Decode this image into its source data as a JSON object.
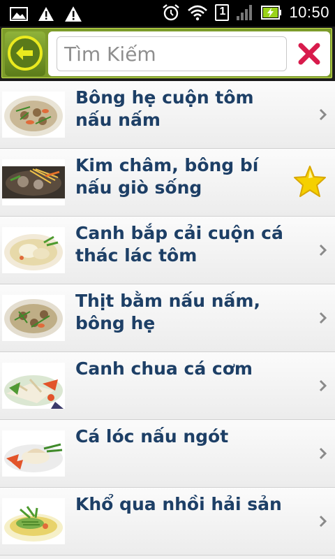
{
  "status_bar": {
    "time": "10:50",
    "sim_slot": "1",
    "icons": [
      "image-notification-icon",
      "warning-icon",
      "warning-icon",
      "alarm-icon",
      "wifi-icon",
      "sim-icon",
      "signal-icon",
      "battery-charging-icon"
    ]
  },
  "search": {
    "placeholder": "Tìm Kiếm",
    "value": ""
  },
  "colors": {
    "title_text": "#1d3f66",
    "toolbar_green": "#7d9c2b",
    "back_button_yellow": "#e8e81e",
    "clear_x": "#d81b4c",
    "star": "#f5d000"
  },
  "recipes": [
    {
      "title": "Bông hẹ cuộn tôm nấu nấm",
      "favorite": false
    },
    {
      "title": "Kim châm, bông bí nấu giò sống",
      "favorite": true
    },
    {
      "title": "Canh bắp cải cuộn cá thác lác tôm",
      "favorite": false
    },
    {
      "title": "Thịt bằm nấu nấm, bông hẹ",
      "favorite": false
    },
    {
      "title": "Canh chua cá cơm",
      "favorite": false
    },
    {
      "title": "Cá lóc nấu ngót",
      "favorite": false
    },
    {
      "title": "Khổ qua nhồi hải sản",
      "favorite": false
    }
  ]
}
